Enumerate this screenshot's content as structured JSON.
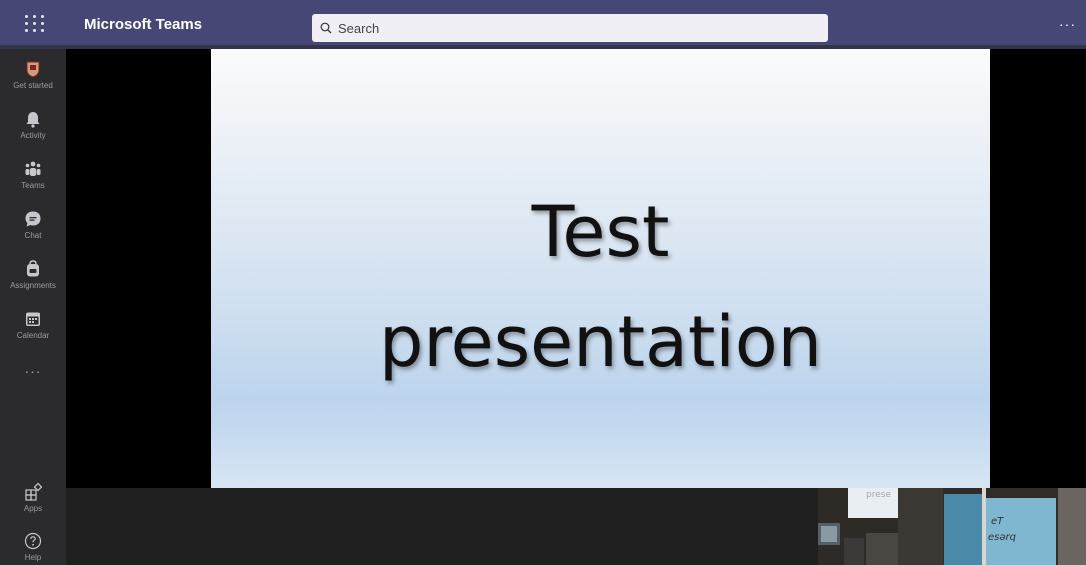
{
  "app": {
    "title": "Microsoft Teams"
  },
  "search": {
    "placeholder": "Search"
  },
  "topbar": {
    "more_label": "···"
  },
  "rail": {
    "items": [
      {
        "label": "Get started",
        "icon": "crest-icon"
      },
      {
        "label": "Activity",
        "icon": "bell-icon"
      },
      {
        "label": "Teams",
        "icon": "teams-icon"
      },
      {
        "label": "Chat",
        "icon": "chat-icon"
      },
      {
        "label": "Assignments",
        "icon": "backpack-icon"
      },
      {
        "label": "Calendar",
        "icon": "calendar-icon"
      }
    ],
    "more_label": "···",
    "bottom_items": [
      {
        "label": "Apps",
        "icon": "apps-icon"
      },
      {
        "label": "Help",
        "icon": "help-icon"
      }
    ]
  },
  "slide": {
    "line1": "Test",
    "line2": "presentation"
  },
  "thumbnails": {
    "thumb1_text": "prese",
    "thumb2_line1": "eT",
    "thumb2_line2": "esərq"
  },
  "colors": {
    "topbar": "#464775",
    "rail": "#2b2b2e",
    "stage": "#000000"
  }
}
